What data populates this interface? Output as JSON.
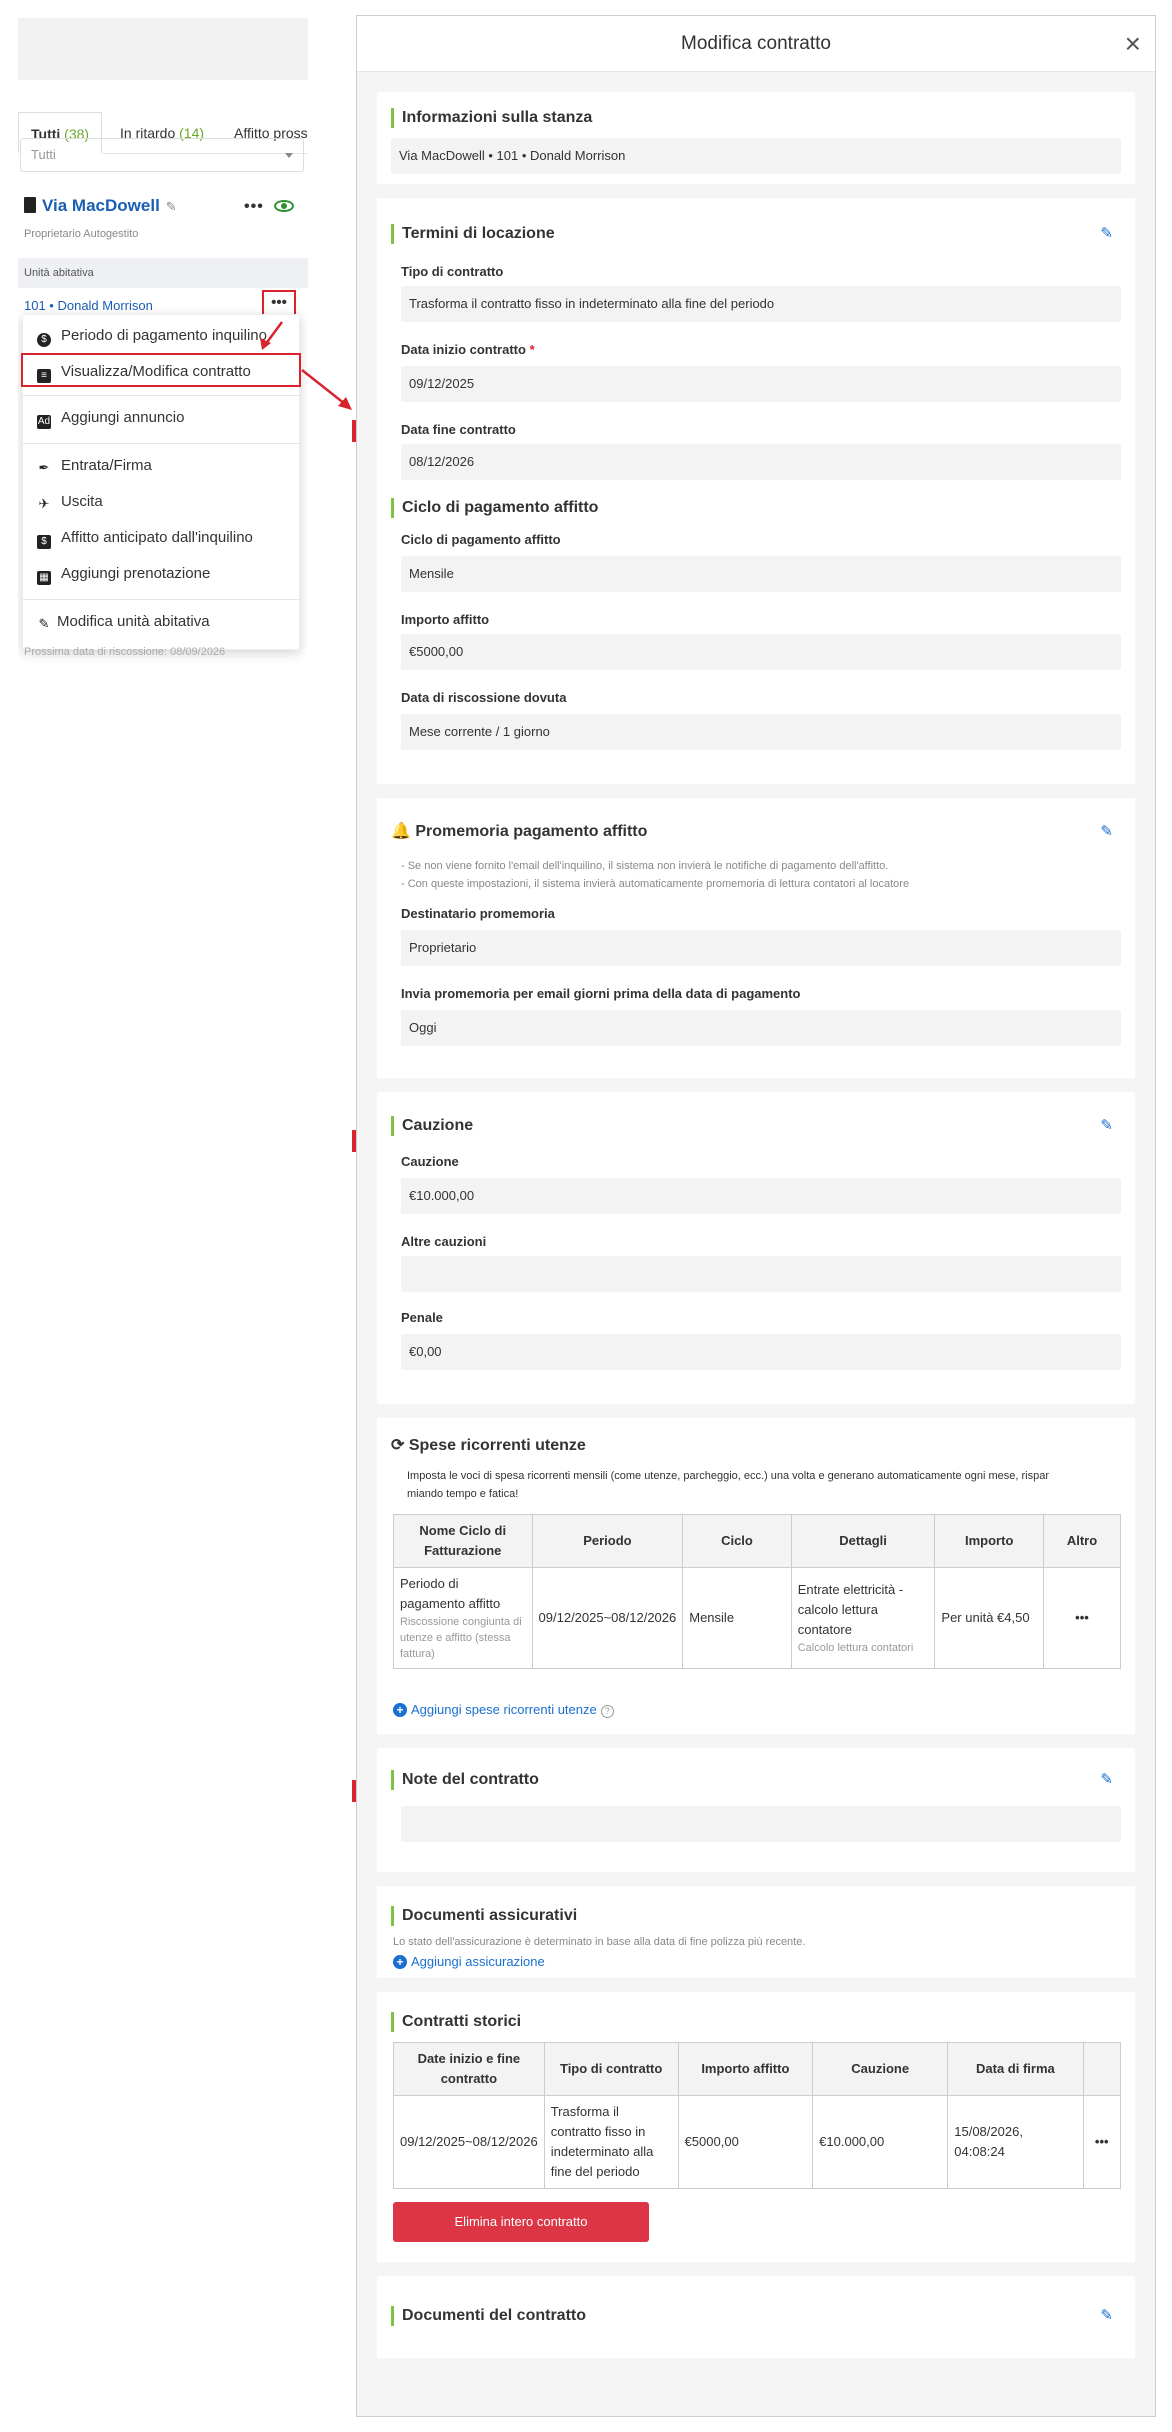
{
  "left": {
    "tabs": [
      {
        "label": "Tutti",
        "count": "(38)"
      },
      {
        "label": "In ritardo",
        "count": "(14)"
      },
      {
        "label": "Affitto pross",
        "count": ""
      }
    ],
    "filter": {
      "value": "Tutti"
    },
    "building": {
      "name": "Via MacDowell",
      "owner": "Proprietario Autogestito",
      "more": "•••"
    },
    "unit_header": "Unità abitativa",
    "unit_row": "101 • Donald Morrison",
    "unit_more": "•••",
    "menu": [
      {
        "label": "Periodo di pagamento inquilino",
        "icon": "dollar-icon"
      },
      {
        "label": "Visualizza/Modifica contratto",
        "icon": "document-icon"
      },
      {
        "label": "Aggiungi annuncio",
        "icon": "ad-icon"
      },
      {
        "label": "Entrata/Firma",
        "icon": "pen-icon"
      },
      {
        "label": "Uscita",
        "icon": "walk-icon"
      },
      {
        "label": "Affitto anticipato dall'inquilino",
        "icon": "prepay-icon"
      },
      {
        "label": "Aggiungi prenotazione",
        "icon": "calendar-icon"
      },
      {
        "label": "Modifica unità abitativa",
        "icon": "edit-icon"
      }
    ],
    "next_collection": "Prossima data di riscossione: 08/09/2026"
  },
  "modal": {
    "title": "Modifica contratto",
    "close": "×",
    "room": {
      "title": "Informazioni sulla stanza",
      "value": "Via MacDowell • 101 • Donald Morrison"
    },
    "lease": {
      "title": "Termini di locazione",
      "contract_type_label": "Tipo di contratto",
      "contract_type": "Trasforma il contratto fisso in indeterminato alla fine del periodo",
      "start_label": "Data inizio contratto",
      "required": "*",
      "start": "09/12/2025",
      "end_label": "Data fine contratto",
      "end": "08/12/2026"
    },
    "cycle": {
      "title": "Ciclo di pagamento affitto",
      "cycle_label": "Ciclo di pagamento affitto",
      "cycle": "Mensile",
      "amount_label": "Importo affitto",
      "amount": "€5000,00",
      "due_label": "Data di riscossione dovuta",
      "due": "Mese corrente / 1 giorno"
    },
    "reminder": {
      "title": "Promemoria pagamento affitto",
      "hint1": "- Se non viene fornito l'email dell'inquilino, il sistema non invierà le notifiche di pagamento dell'affitto.",
      "hint2": "- Con queste impostazioni, il sistema invierà automaticamente promemoria di lettura contatori al locatore",
      "recipient_label": "Destinatario promemoria",
      "recipient": "Proprietario",
      "days_label": "Invia promemoria per email giorni prima della data di pagamento",
      "days": "Oggi"
    },
    "deposit": {
      "title": "Cauzione",
      "deposit_label": "Cauzione",
      "deposit": "€10.000,00",
      "other_label": "Altre cauzioni",
      "other": "",
      "penalty_label": "Penale",
      "penalty": "€0,00"
    },
    "utilities": {
      "title": "Spese ricorrenti utenze",
      "desc1": "Imposta le voci di spesa ricorrenti mensili (come utenze, parcheggio, ecc.) una volta e generano automaticamente ogni mese, rispar",
      "desc2": "miando tempo e fatica!",
      "headers": [
        "Nome Ciclo di Fatturazione",
        "Periodo",
        "Ciclo",
        "Dettagli",
        "Importo",
        "Altro"
      ],
      "row": {
        "name": "Periodo di pagamento affitto",
        "name_sub": "Riscossione congiunta di utenze e affitto (stessa fattura)",
        "period": "09/12/2025~08/12/2026",
        "cycle": "Mensile",
        "details": "Entrate elettricità - calcolo lettura contatore",
        "details_sub": "Calcolo lettura contatori",
        "amount": "Per unità €4,50",
        "more": "•••"
      },
      "add": "Aggiungi spese ricorrenti utenze"
    },
    "notes": {
      "title": "Note del contratto",
      "value": ""
    },
    "insurance": {
      "title": "Documenti assicurativi",
      "hint": "Lo stato dell'assicurazione è determinato in base alla data di fine polizza più recente.",
      "add": "Aggiungi assicurazione"
    },
    "history": {
      "title": "Contratti storici",
      "headers": [
        "Date inizio e fine contratto",
        "Tipo di contratto",
        "Importo affitto",
        "Cauzione",
        "Data di firma",
        ""
      ],
      "row": {
        "dates": "09/12/2025~08/12/2026",
        "type": "Trasforma il contratto fisso in indeterminato alla fine del periodo",
        "rent": "€5000,00",
        "deposit": "€10.000,00",
        "signed": "15/08/2026, 04:08:24",
        "more": "•••"
      },
      "delete": "Elimina intero contratto"
    },
    "docs": {
      "title": "Documenti del contratto"
    }
  }
}
